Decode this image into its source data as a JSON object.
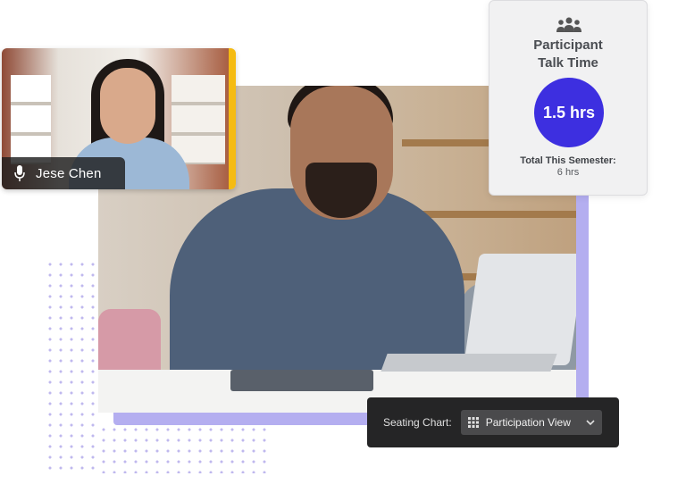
{
  "participant_tile": {
    "name": "Jese Chen",
    "mic_icon": "microphone-icon",
    "accent_color": "#f5bb12"
  },
  "talk_time_card": {
    "icon": "people-group-icon",
    "title_line1": "Participant",
    "title_line2": "Talk Time",
    "value": "1.5 hrs",
    "total_label": "Total This Semester:",
    "total_value": "6 hrs",
    "circle_color": "#3d2fe0"
  },
  "seating_chart": {
    "label": "Seating Chart:",
    "selected_view": "Participation View",
    "view_icon": "grid-icon",
    "dropdown_icon": "chevron-down-icon"
  },
  "decor": {
    "frame_color": "#b4aef0",
    "dot_color": "#bfb8ee"
  }
}
